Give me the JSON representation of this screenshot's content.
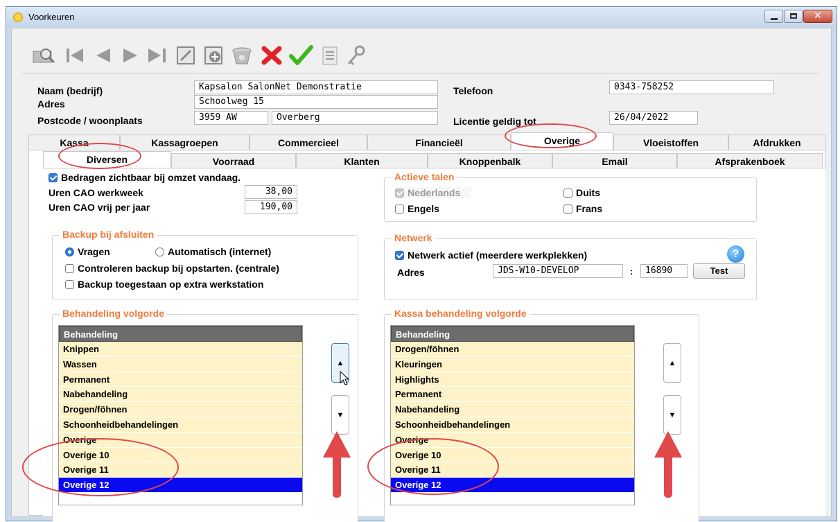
{
  "window": {
    "title": "Voorkeuren"
  },
  "company": {
    "name_label": "Naam (bedrijf)",
    "name_value": "Kapsalon SalonNet Demonstratie",
    "address_label": "Adres",
    "address_value": "Schoolweg 15",
    "postcode_label": "Postcode / woonplaats",
    "postcode_value": "3959 AW",
    "city_value": "Overberg",
    "phone_label": "Telefoon",
    "phone_value": "0343-758252",
    "license_label": "Licentie geldig tot",
    "license_value": "26/04/2022"
  },
  "main_tabs": [
    "Kassa",
    "Kassagroepen",
    "Commercieel",
    "Financieël",
    "Overige",
    "Vloeistoffen",
    "Afdrukken"
  ],
  "sub_tabs": [
    "Diversen",
    "Voorraad",
    "Klanten",
    "Knoppenbalk",
    "Email",
    "Afsprakenboek"
  ],
  "diversen": {
    "show_amounts_label": "Bedragen zichtbaar bij omzet vandaag.",
    "show_amounts_checked": true,
    "hours_week_label": "Uren CAO werkweek",
    "hours_week_value": "38,00",
    "hours_year_label": "Uren CAO vrij per jaar",
    "hours_year_value": "190,00"
  },
  "languages": {
    "title": "Actieve talen",
    "dutch": "Nederlands",
    "german": "Duits",
    "english": "Engels",
    "french": "Frans"
  },
  "backup": {
    "title": "Backup bij afsluiten",
    "ask": "Vragen",
    "automatic": "Automatisch (internet)",
    "check_startup": "Controleren backup bij opstarten. (centrale)",
    "allow_extra": "Backup toegestaan op extra werkstation"
  },
  "network": {
    "title": "Netwerk",
    "active_label": "Netwerk actief (meerdere werkplekken)",
    "address_label": "Adres",
    "host": "JDS-W10-DEVELOP",
    "separator": ":",
    "port": "16890",
    "test_button": "Test"
  },
  "treatment_order": {
    "title": "Behandeling volgorde",
    "header": "Behandeling",
    "items": [
      "Knippen",
      "Wassen",
      "Permanent",
      "Nabehandeling",
      "Drogen/föhnen",
      "Schoonheidbehandelingen",
      "Overige",
      "Overige 10",
      "Overige 11",
      "Overige 12"
    ],
    "selected_index": 9
  },
  "register_order": {
    "title": "Kassa behandeling volgorde",
    "header": "Behandeling",
    "items": [
      "Drogen/föhnen",
      "Kleuringen",
      "Highlights",
      "Permanent",
      "Nabehandeling",
      "Schoonheidbehandelingen",
      "Overige",
      "Overige 10",
      "Overige 11",
      "Overige 12"
    ],
    "selected_index": 9
  },
  "colors": {
    "accent": "#f07b3c",
    "selection": "#0a0af0",
    "annotation": "#e0484a",
    "row": "#fdf2c8"
  },
  "toolbar_icons": [
    "search-icon",
    "first-record-icon",
    "previous-record-icon",
    "next-record-icon",
    "last-record-icon",
    "edit-icon",
    "add-icon",
    "delete-icon",
    "cancel-icon",
    "confirm-icon",
    "list-icon",
    "keys-icon"
  ]
}
